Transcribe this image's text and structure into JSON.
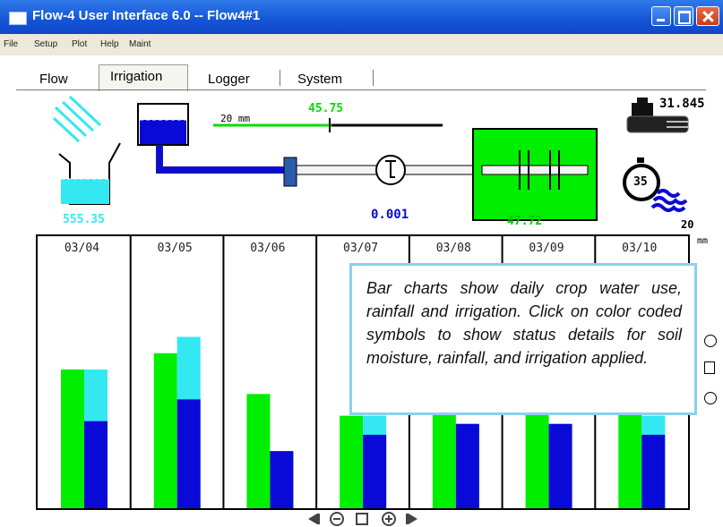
{
  "window": {
    "title": "Flow-4 User Interface 6.0 -- Flow4#1",
    "menu": [
      "File",
      "Setup",
      "Plot",
      "Help",
      "Maint"
    ]
  },
  "tabs": [
    {
      "label": "Flow",
      "selected": false
    },
    {
      "label": "Irrigation",
      "selected": true
    },
    {
      "label": "Logger",
      "selected": false
    },
    {
      "label": "System",
      "selected": false
    }
  ],
  "diagram": {
    "rain_gauge_value": "555.35",
    "valve_scale_label": "20 mm",
    "valve_setpoint": "45.75",
    "flow_meter_value": "0.001",
    "field_value": "47.72",
    "pump_value": "31.845",
    "timer_value": "35",
    "depth_value": "20",
    "depth_unit": "mm",
    "colors": {
      "water": "#0a0ad8",
      "rain": "#33e8f0",
      "crop": "#00ee00",
      "pipe": "#1a1aa8"
    }
  },
  "callout": {
    "text": "Bar charts show daily crop water use, rainfall and irrigation.  Click on color coded symbols to show status details for soil moisture, rainfall, and irrigation applied."
  },
  "chart_data": {
    "type": "bar",
    "categories": [
      "03/04",
      "03/05",
      "03/06",
      "03/07",
      "03/08",
      "03/09",
      "03/10"
    ],
    "series": [
      {
        "color": "#00ee00",
        "values": [
          0.51,
          0.57,
          0.42,
          0.34,
          0.4,
          0.4,
          0.4
        ]
      },
      {
        "color": "#33e8f0",
        "values": [
          0.51,
          0.63,
          0.21,
          0.34,
          0.31,
          0.31,
          0.34
        ]
      },
      {
        "color": "#0a0ad8",
        "values": [
          0.32,
          0.4,
          0.21,
          0.27,
          0.31,
          0.31,
          0.27
        ]
      }
    ],
    "ylim": [
      0,
      1
    ]
  },
  "nav": {
    "icons": [
      "rewind-icon",
      "zoom-out-icon",
      "stop-icon",
      "zoom-in-icon",
      "forward-icon"
    ]
  }
}
